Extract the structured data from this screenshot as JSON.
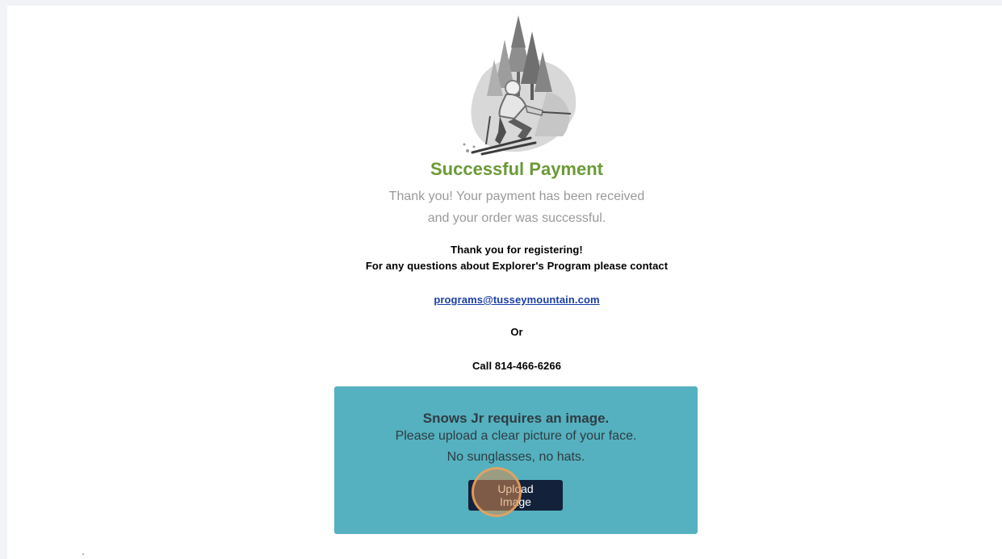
{
  "success": {
    "title": "Successful Payment",
    "message_line1": "Thank you! Your payment has been received",
    "message_line2": "and your order was successful."
  },
  "registration": {
    "line1": "Thank you for registering!",
    "line2": "For any questions about Explorer's Program please contact",
    "email": "programs@tusseymountain.com",
    "or_text": "Or",
    "call_text": "Call 814-466-6266"
  },
  "upload": {
    "title": "Snows Jr requires an image.",
    "line1": "Please upload a clear picture of your face.",
    "line2": "No sunglasses, no hats.",
    "button_line1": "Upload",
    "button_line2": "Image"
  },
  "icons": {
    "hero": "skier-illustration-icon"
  },
  "colors": {
    "title_green": "#6a9a36",
    "panel_teal": "#55b1bf",
    "button_navy": "#14213a",
    "link_blue": "#1a3fa6",
    "click_indicator": "#d68c50"
  }
}
